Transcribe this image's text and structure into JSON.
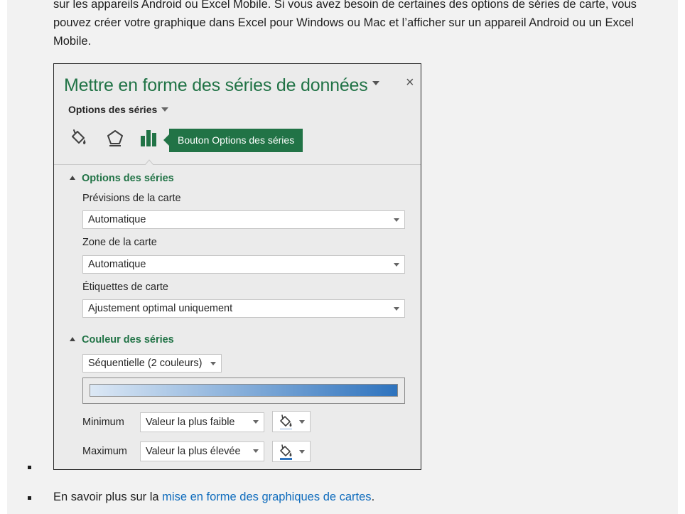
{
  "article": {
    "intro_paragraph": "sur les appareils Android ou Excel Mobile. Si vous avez besoin de certaines des options de séries de carte, vous pouvez créer votre graphique dans Excel pour Windows ou Mac et l’afficher sur un appareil Android ou un Excel Mobile.",
    "learn_more_prefix": "En savoir plus sur la ",
    "learn_more_link": "mise en forme des graphiques de cartes",
    "learn_more_suffix": "."
  },
  "panel": {
    "title": "Mettre en forme des séries de données",
    "close_label": "×",
    "options_dropdown": "Options des séries",
    "tabs": [
      {
        "icon": "fill-line-icon"
      },
      {
        "icon": "effects-pentagon-icon"
      },
      {
        "icon": "series-options-bar-icon",
        "selected": true
      }
    ],
    "tooltip": "Bouton Options des séries",
    "section_series_options": {
      "heading": "Options des séries",
      "map_projection_label": "Prévisions de la carte",
      "map_projection_value": "Automatique",
      "map_area_label": "Zone de la carte",
      "map_area_value": "Automatique",
      "map_labels_label": "Étiquettes de carte",
      "map_labels_value": "Ajustement optimal uniquement"
    },
    "section_series_color": {
      "heading": "Couleur des séries",
      "color_scheme_value": "Séquentielle (2 couleurs)",
      "gradient_start_color": "#dce8f5",
      "gradient_end_color": "#2e73be",
      "minimum_label": "Minimum",
      "minimum_value": "Valeur la plus faible",
      "minimum_swatch_color": "#dbe6f4",
      "maximum_label": "Maximum",
      "maximum_value": "Valeur la plus élevée",
      "maximum_swatch_color": "#2e73be"
    }
  },
  "colors": {
    "accent_green": "#217346",
    "link_blue": "#0f6cbd"
  }
}
